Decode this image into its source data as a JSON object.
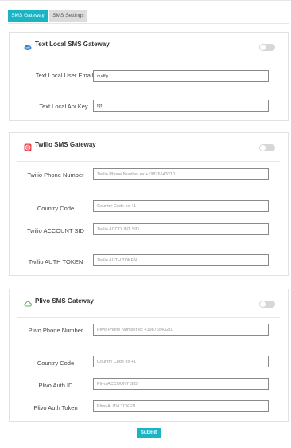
{
  "tabs": [
    {
      "label": "SMS Gateway",
      "active": true
    },
    {
      "label": "SMS Settings",
      "active": false
    }
  ],
  "textlocal": {
    "title": "Text Local SMS Gateway",
    "icon": "cloud-icon",
    "enabled": false,
    "fields": [
      {
        "label": "Text Local User Email",
        "value": "qudfg",
        "placeholder": ""
      },
      {
        "label": "Text Local Api Key",
        "value": "fgf",
        "placeholder": ""
      }
    ]
  },
  "twilio": {
    "title": "Twilio SMS Gateway",
    "icon": "twilio-icon",
    "enabled": false,
    "fields": [
      {
        "label": "Twilio Phone Number",
        "value": "",
        "placeholder": "Twilio Phone Number ex +19876543210"
      },
      {
        "label": "Country Code",
        "value": "",
        "placeholder": "Country Code ex +1"
      },
      {
        "label": "Twilio ACCOUNT SID",
        "value": "",
        "placeholder": "Twilio ACCOUNT SID"
      },
      {
        "label": "Twilio AUTH TOKEN",
        "value": "",
        "placeholder": "Twilio AUTH TOKEN"
      }
    ]
  },
  "plivo": {
    "title": "Plivo SMS Gateway",
    "icon": "plivo-cloud-icon",
    "enabled": false,
    "fields": [
      {
        "label": "Plivo Phone Number",
        "value": "",
        "placeholder": "Plivo Phone Number ex +19876543210"
      },
      {
        "label": "Country Code",
        "value": "",
        "placeholder": "Country Code ex +1"
      },
      {
        "label": "Plivo Auth ID",
        "value": "",
        "placeholder": "Plivo ACCOUNT SID"
      },
      {
        "label": "Plivo Auth Token",
        "value": "",
        "placeholder": "Plivo AUTH TOKEN"
      }
    ]
  },
  "submit_label": "Submit",
  "colors": {
    "accent": "#1ab5c4",
    "toggle_off": "#d7d7d7",
    "twilio": "#e8424c",
    "plivo": "#5cb85c",
    "textlocal": "#3a7bd5"
  }
}
